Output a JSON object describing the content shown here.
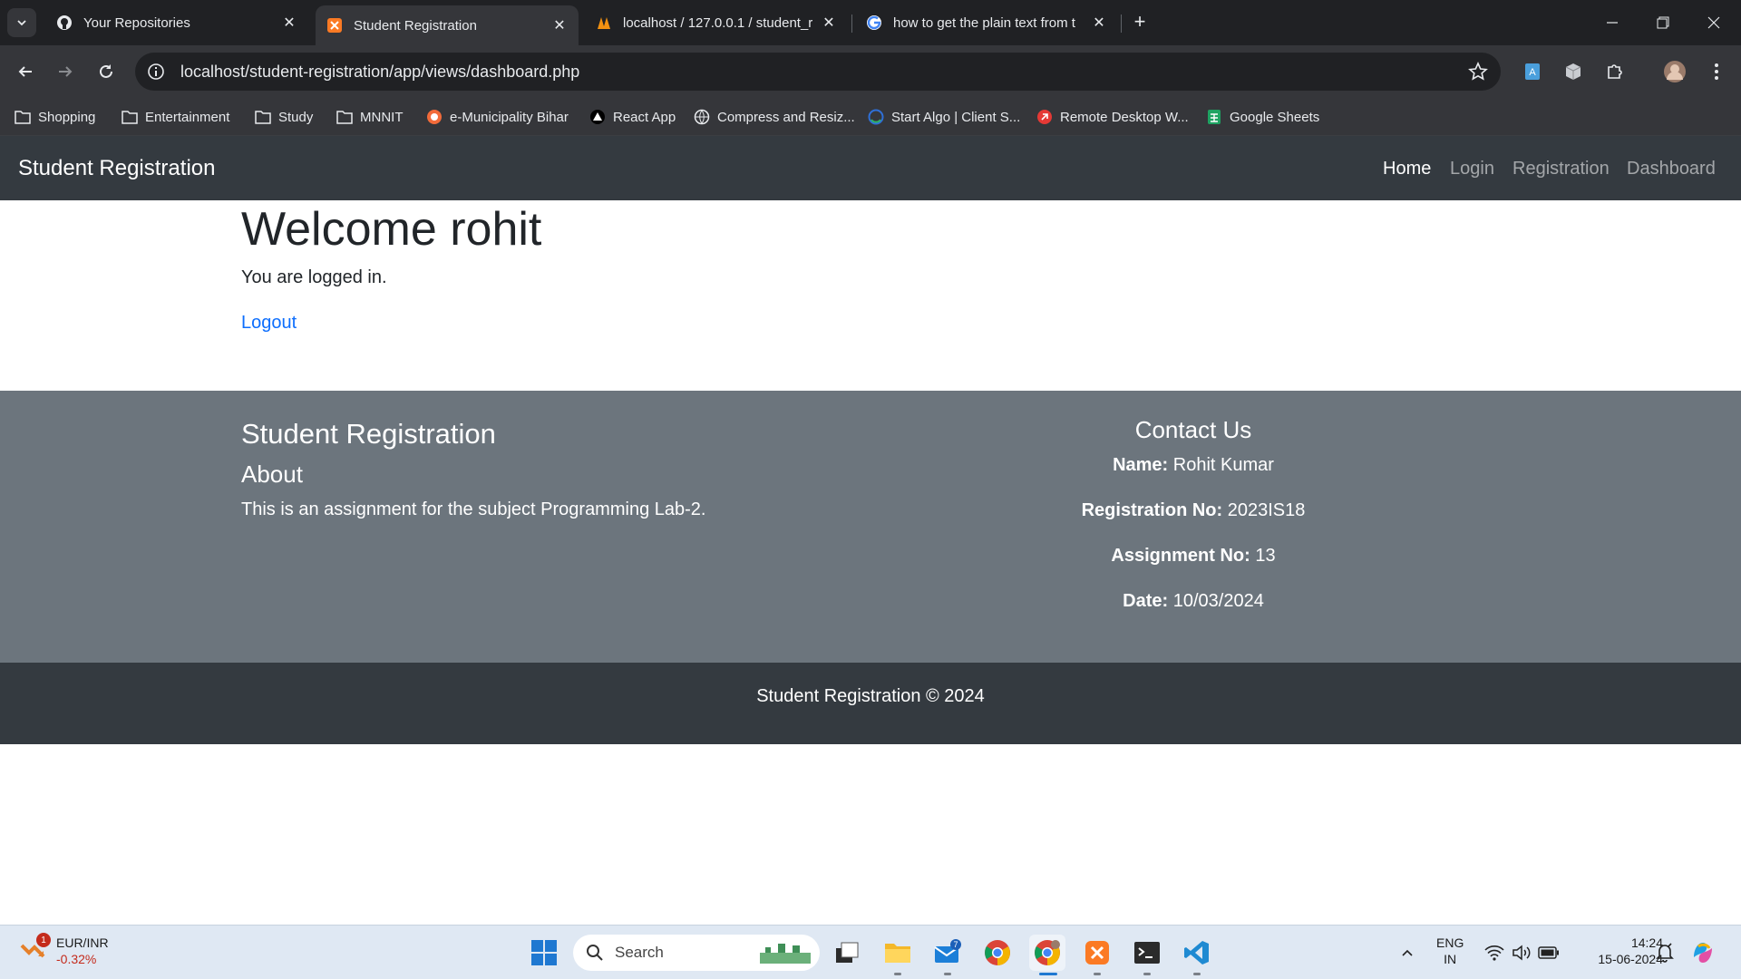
{
  "browser": {
    "tabs": [
      {
        "title": "Your Repositories",
        "favicon": "github-icon"
      },
      {
        "title": "Student Registration",
        "favicon": "xampp-icon",
        "active": true
      },
      {
        "title": "localhost / 127.0.0.1 / student_r",
        "favicon": "phpmyadmin-icon"
      },
      {
        "title": "how to get the plain text from t",
        "favicon": "google-icon"
      }
    ],
    "url": "localhost/student-registration/app/views/dashboard.php",
    "bookmarks": [
      {
        "label": "Shopping",
        "icon": "folder-icon"
      },
      {
        "label": "Entertainment",
        "icon": "folder-icon"
      },
      {
        "label": "Study",
        "icon": "folder-icon"
      },
      {
        "label": "MNNIT",
        "icon": "folder-icon"
      },
      {
        "label": "e-Municipality Bihar",
        "icon": "municipality-icon"
      },
      {
        "label": "React App",
        "icon": "react-app-icon"
      },
      {
        "label": "Compress and Resiz...",
        "icon": "globe-icon"
      },
      {
        "label": "Start Algo | Client S...",
        "icon": "startalgo-icon"
      },
      {
        "label": "Remote Desktop W...",
        "icon": "remote-desktop-icon"
      },
      {
        "label": "Google Sheets",
        "icon": "sheets-icon"
      }
    ]
  },
  "navbar": {
    "brand": "Student Registration",
    "links": [
      "Home",
      "Login",
      "Registration",
      "Dashboard"
    ]
  },
  "main": {
    "heading": "Welcome rohit",
    "status": "You are logged in.",
    "logout": "Logout"
  },
  "footer": {
    "title": "Student Registration",
    "about_heading": "About",
    "about_text": "This is an assignment for the subject Programming Lab-2.",
    "contact": {
      "heading": "Contact Us",
      "rows": [
        {
          "label": "Name:",
          "value": "Rohit Kumar"
        },
        {
          "label": "Registration No:",
          "value": "2023IS18"
        },
        {
          "label": "Assignment No:",
          "value": "13"
        },
        {
          "label": "Date:",
          "value": "10/03/2024"
        }
      ]
    },
    "copyright": "Student Registration © 2024"
  },
  "taskbar": {
    "widget": {
      "badge": "1",
      "title": "EUR/INR",
      "change": "-0.32%"
    },
    "search_label": "Search",
    "mail_badge": "7",
    "lang": "ENG",
    "region": "IN",
    "time": "14:24",
    "date": "15-06-2024"
  },
  "colors": {
    "navbar": "#343a40",
    "footer": "#6c757d",
    "link": "#0d6efd"
  }
}
